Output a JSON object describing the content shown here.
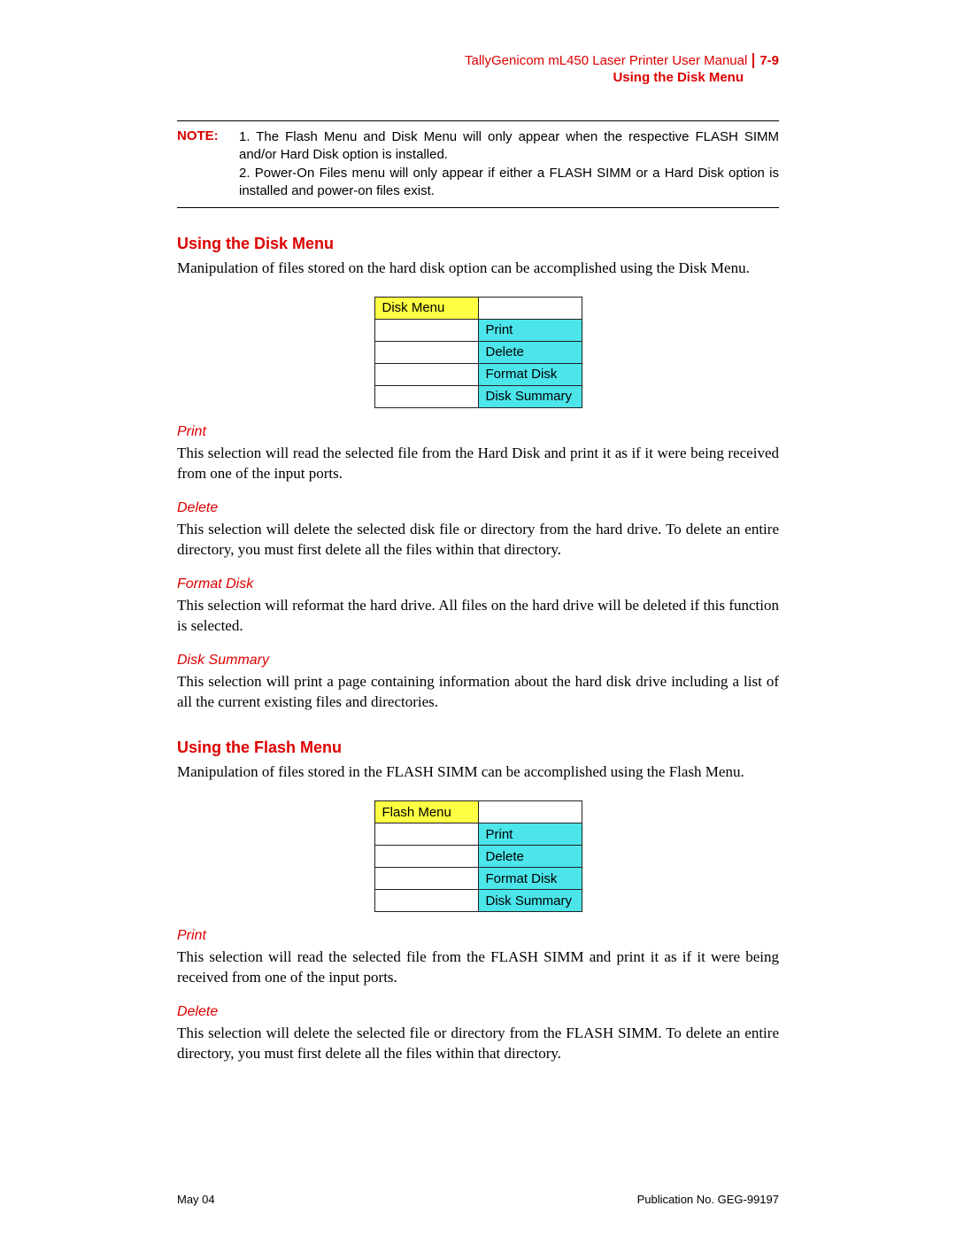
{
  "header": {
    "title": "TallyGenicom mL450 Laser Printer User Manual",
    "pagenum": "7-9",
    "sub": "Using the Disk Menu"
  },
  "note": {
    "label": "NOTE:",
    "line1": "1. The Flash Menu and Disk Menu will only appear when the respective FLASH SIMM and/or Hard Disk option is installed.",
    "line2": "2. Power-On Files menu will only appear if either a FLASH SIMM or a Hard Disk option is installed and power-on files exist."
  },
  "disk": {
    "title": "Using the Disk Menu",
    "intro": "Manipulation of files stored on the hard disk option can be accomplished using the Disk Menu.",
    "menuLabel": "Disk Menu",
    "options": [
      "Print",
      "Delete",
      "Format Disk",
      "Disk Summary"
    ],
    "sections": {
      "print": {
        "title": "Print",
        "text": "This selection will read the selected file from the Hard Disk and print it as if it were being received from one of the input ports."
      },
      "delete": {
        "title": "Delete",
        "text": "This selection will delete the selected disk file or directory from the hard drive. To delete an entire directory, you must first delete all the files within that directory."
      },
      "format": {
        "title": "Format Disk",
        "text": "This selection will reformat the hard drive. All files on the hard drive will be deleted if this function is selected."
      },
      "summary": {
        "title": "Disk Summary",
        "text": "This selection will print a page containing information about the hard disk drive including a list of all the current existing files and directories."
      }
    }
  },
  "flash": {
    "title": "Using the Flash Menu",
    "intro": "Manipulation of files stored in the FLASH SIMM can be accomplished using the Flash Menu.",
    "menuLabel": "Flash Menu",
    "options": [
      "Print",
      "Delete",
      "Format Disk",
      "Disk Summary"
    ],
    "sections": {
      "print": {
        "title": "Print",
        "text": "This selection will read the selected file from the FLASH SIMM and print it as if it were being received from one of the input ports."
      },
      "delete": {
        "title": "Delete",
        "text": "This selection will delete the selected file or directory from the FLASH SIMM. To delete an entire directory, you must first delete all the files within that directory."
      }
    }
  },
  "footer": {
    "left": "May 04",
    "right": "Publication No. GEG-99197"
  }
}
